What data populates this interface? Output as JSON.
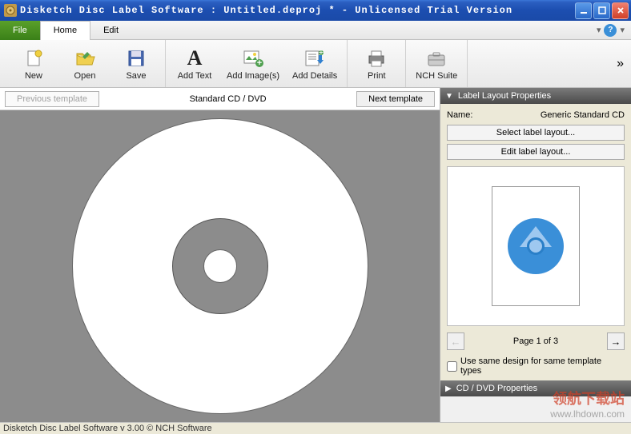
{
  "window": {
    "title": "Disketch Disc Label Software : Untitled.deproj * - Unlicensed Trial Version"
  },
  "menu": {
    "file": "File",
    "home": "Home",
    "edit": "Edit"
  },
  "ribbon": {
    "new": "New",
    "open": "Open",
    "save": "Save",
    "add_text": "Add Text",
    "add_images": "Add Image(s)",
    "add_details": "Add Details",
    "print": "Print",
    "nch_suite": "NCH Suite"
  },
  "canvas": {
    "prev_template": "Previous template",
    "template_name": "Standard CD / DVD",
    "next_template": "Next template"
  },
  "sidebar": {
    "label_layout_header": "Label Layout Properties",
    "name_label": "Name:",
    "name_value": "Generic Standard CD",
    "select_layout": "Select label layout...",
    "edit_layout": "Edit label layout...",
    "page_info": "Page 1 of 3",
    "same_design": "Use same design for same template types",
    "cd_dvd_header": "CD / DVD Properties"
  },
  "status": "Disketch Disc Label Software v 3.00 © NCH Software",
  "watermark": {
    "line1": "领航下载站",
    "line2": "www.lhdown.com"
  }
}
